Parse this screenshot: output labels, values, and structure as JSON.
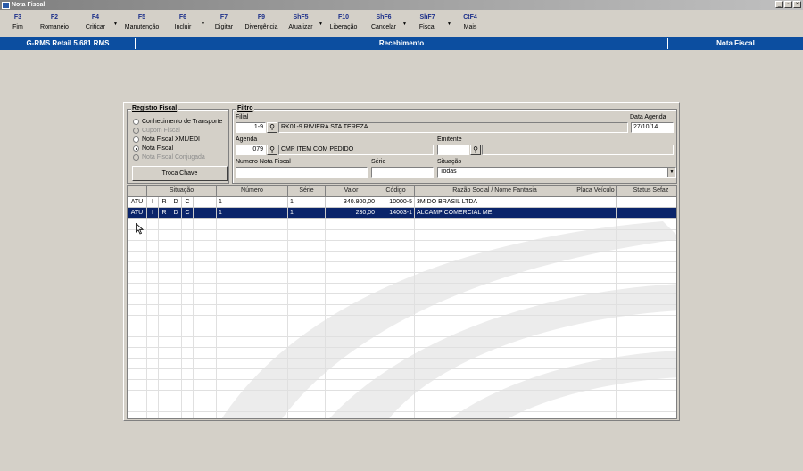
{
  "window": {
    "title": "Nota Fiscal",
    "btn_min": "_",
    "btn_max": "▫",
    "btn_close": "×"
  },
  "toolbar": [
    {
      "key": "F3",
      "label": "Fim",
      "arrow": false
    },
    {
      "key": "F2",
      "label": "Romaneio",
      "arrow": false
    },
    {
      "key": "F4",
      "label": "Criticar",
      "arrow": true
    },
    {
      "key": "F5",
      "label": "Manutenção",
      "arrow": false
    },
    {
      "key": "F6",
      "label": "Incluir",
      "arrow": true
    },
    {
      "key": "F7",
      "label": "Digitar",
      "arrow": false
    },
    {
      "key": "F9",
      "label": "Divergência",
      "arrow": false
    },
    {
      "key": "ShF5",
      "label": "Atualizar",
      "arrow": true
    },
    {
      "key": "F10",
      "label": "Liberação",
      "arrow": false
    },
    {
      "key": "ShF6",
      "label": "Cancelar",
      "arrow": true
    },
    {
      "key": "ShF7",
      "label": "Fiscal",
      "arrow": true
    },
    {
      "key": "CtF4",
      "label": "Mais",
      "arrow": false
    }
  ],
  "header": {
    "app": "G-RMS Retail 5.681 RMS",
    "module": "Recebimento",
    "screen": "Nota Fiscal"
  },
  "registro": {
    "title": "Registro Fiscal",
    "options": [
      {
        "label": "Conhecimento de Transporte",
        "checked": false,
        "disabled": false
      },
      {
        "label": "Cupom Fiscal",
        "checked": false,
        "disabled": true
      },
      {
        "label": "Nota Fiscal XML/EDI",
        "checked": false,
        "disabled": false
      },
      {
        "label": "Nota Fiscal",
        "checked": true,
        "disabled": false
      },
      {
        "label": "Nota Fiscal Conjugada",
        "checked": false,
        "disabled": true
      }
    ],
    "troca_chave": "Troca Chave"
  },
  "filtro": {
    "title": "Filtro",
    "filial_label": "Filial",
    "filial_code": "1-9",
    "filial_name": "RK01-9 RIVIERA STA TEREZA",
    "data_agenda_label": "Data Agenda",
    "data_agenda": "27/10/14",
    "agenda_label": "Agenda",
    "agenda_code": "079",
    "agenda_desc": "CMP ITEM COM PEDIDO",
    "emitente_label": "Emitente",
    "emitente_code": "",
    "emitente_name": "",
    "numero_label": "Numero Nota Fiscal",
    "numero": "",
    "serie_label": "Série",
    "serie": "",
    "situacao_label": "Situação",
    "situacao": "Todas"
  },
  "grid": {
    "columns": [
      "",
      "Situação",
      "",
      "",
      "",
      "",
      "Número",
      "Série",
      "Valor",
      "Código",
      "Razão Social / Nome Fantasia",
      "Placa Veículo",
      "Status Sefaz"
    ],
    "rows": [
      {
        "atu": "ATU",
        "s1": "I",
        "s2": "R",
        "s3": "D",
        "s4": "C",
        "s5": "",
        "numero": "1",
        "serie": "1",
        "valor": "340.800,00",
        "codigo": "10000-5",
        "razao": "3M DO BRASIL LTDA",
        "placa": "",
        "status": "",
        "selected": false
      },
      {
        "atu": "ATU",
        "s1": "I",
        "s2": "R",
        "s3": "D",
        "s4": "C",
        "s5": "",
        "numero": "1",
        "serie": "1",
        "valor": "230,00",
        "codigo": "14003-1",
        "razao": "ALCAMP COMERCIAL ME",
        "placa": "",
        "status": "",
        "selected": true
      }
    ]
  }
}
